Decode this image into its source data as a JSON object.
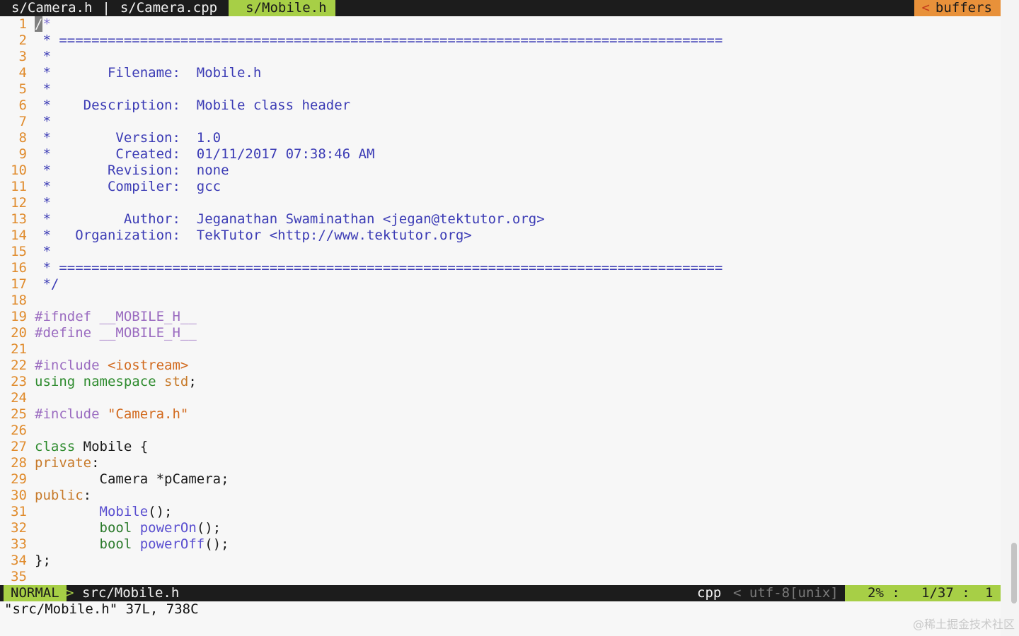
{
  "tabline": {
    "tabs": [
      "s/Camera.h",
      "|",
      "s/Camera.cpp",
      "s/Mobile.h"
    ],
    "active_index": 3,
    "buffers_arrow": "<",
    "buffers_label": "buffers"
  },
  "editor": {
    "cursor_char": "/",
    "lines": [
      {
        "n": "1",
        "segments": [
          {
            "c": "cmr",
            "t": "*"
          }
        ]
      },
      {
        "n": "2",
        "segments": [
          {
            "c": "cm",
            "t": " * =================================================================================="
          }
        ]
      },
      {
        "n": "3",
        "segments": [
          {
            "c": "cm",
            "t": " *"
          }
        ]
      },
      {
        "n": "4",
        "segments": [
          {
            "c": "cm",
            "t": " *       Filename:  Mobile.h"
          }
        ]
      },
      {
        "n": "5",
        "segments": [
          {
            "c": "cm",
            "t": " *"
          }
        ]
      },
      {
        "n": "6",
        "segments": [
          {
            "c": "cm",
            "t": " *    Description:  Mobile class header"
          }
        ]
      },
      {
        "n": "7",
        "segments": [
          {
            "c": "cm",
            "t": " *"
          }
        ]
      },
      {
        "n": "8",
        "segments": [
          {
            "c": "cm",
            "t": " *        Version:  1.0"
          }
        ]
      },
      {
        "n": "9",
        "segments": [
          {
            "c": "cm",
            "t": " *        Created:  01/11/2017 07:38:46 AM"
          }
        ]
      },
      {
        "n": "10",
        "segments": [
          {
            "c": "cm",
            "t": " *       Revision:  none"
          }
        ]
      },
      {
        "n": "11",
        "segments": [
          {
            "c": "cm",
            "t": " *       Compiler:  gcc"
          }
        ]
      },
      {
        "n": "12",
        "segments": [
          {
            "c": "cm",
            "t": " *"
          }
        ]
      },
      {
        "n": "13",
        "segments": [
          {
            "c": "cm",
            "t": " *         Author:  Jeganathan Swaminathan <jegan@tektutor.org>"
          }
        ]
      },
      {
        "n": "14",
        "segments": [
          {
            "c": "cm",
            "t": " *   Organization:  TekTutor <http://www.tektutor.org>"
          }
        ]
      },
      {
        "n": "15",
        "segments": [
          {
            "c": "cm",
            "t": " *"
          }
        ]
      },
      {
        "n": "16",
        "segments": [
          {
            "c": "cm",
            "t": " * =================================================================================="
          }
        ]
      },
      {
        "n": "17",
        "segments": [
          {
            "c": "cm",
            "t": " */"
          }
        ]
      },
      {
        "n": "18",
        "segments": []
      },
      {
        "n": "19",
        "segments": [
          {
            "c": "pp",
            "t": "#ifndef __MOBILE_H__"
          }
        ]
      },
      {
        "n": "20",
        "segments": [
          {
            "c": "pp",
            "t": "#define __MOBILE_H__"
          }
        ]
      },
      {
        "n": "21",
        "segments": []
      },
      {
        "n": "22",
        "segments": [
          {
            "c": "pp",
            "t": "#include "
          },
          {
            "c": "st",
            "t": "<iostream>"
          }
        ]
      },
      {
        "n": "23",
        "segments": [
          {
            "c": "kw",
            "t": "using namespace "
          },
          {
            "c": "lb",
            "t": "std"
          },
          {
            "c": "",
            "t": ";"
          }
        ]
      },
      {
        "n": "24",
        "segments": []
      },
      {
        "n": "25",
        "segments": [
          {
            "c": "pp",
            "t": "#include "
          },
          {
            "c": "st",
            "t": "\"Camera.h\""
          }
        ]
      },
      {
        "n": "26",
        "segments": []
      },
      {
        "n": "27",
        "segments": [
          {
            "c": "kw",
            "t": "class"
          },
          {
            "c": "",
            "t": " Mobile {"
          }
        ]
      },
      {
        "n": "28",
        "segments": [
          {
            "c": "lb",
            "t": "private"
          },
          {
            "c": "",
            "t": ":"
          }
        ]
      },
      {
        "n": "29",
        "segments": [
          {
            "c": "",
            "t": "        Camera *pCamera;"
          }
        ]
      },
      {
        "n": "30",
        "segments": [
          {
            "c": "lb",
            "t": "public"
          },
          {
            "c": "",
            "t": ":"
          }
        ]
      },
      {
        "n": "31",
        "segments": [
          {
            "c": "",
            "t": "        "
          },
          {
            "c": "fn",
            "t": "Mobile"
          },
          {
            "c": "",
            "t": "();"
          }
        ]
      },
      {
        "n": "32",
        "segments": [
          {
            "c": "",
            "t": "        "
          },
          {
            "c": "ty",
            "t": "bool"
          },
          {
            "c": "",
            "t": " "
          },
          {
            "c": "fn",
            "t": "powerOn"
          },
          {
            "c": "",
            "t": "();"
          }
        ]
      },
      {
        "n": "33",
        "segments": [
          {
            "c": "",
            "t": "        "
          },
          {
            "c": "ty",
            "t": "bool"
          },
          {
            "c": "",
            "t": " "
          },
          {
            "c": "fn",
            "t": "powerOff"
          },
          {
            "c": "",
            "t": "();"
          }
        ]
      },
      {
        "n": "34",
        "segments": [
          {
            "c": "",
            "t": "};"
          }
        ]
      },
      {
        "n": "35",
        "segments": []
      }
    ]
  },
  "statusline": {
    "mode": "NORMAL",
    "arrow": ">",
    "file": "src/Mobile.h",
    "filetype": "cpp",
    "encoding": "< utf-8[unix] <",
    "percent": "2% :",
    "position": "1/37 :",
    "column": "1"
  },
  "cmdline": {
    "message": "\"src/Mobile.h\" 37L, 738C"
  },
  "watermark": "@稀土掘金技术社区",
  "colors": {
    "accent_green": "#a7cf46",
    "accent_orange": "#e8913a",
    "line_number": "#e08b2c",
    "comment": "#3b3bb5"
  }
}
